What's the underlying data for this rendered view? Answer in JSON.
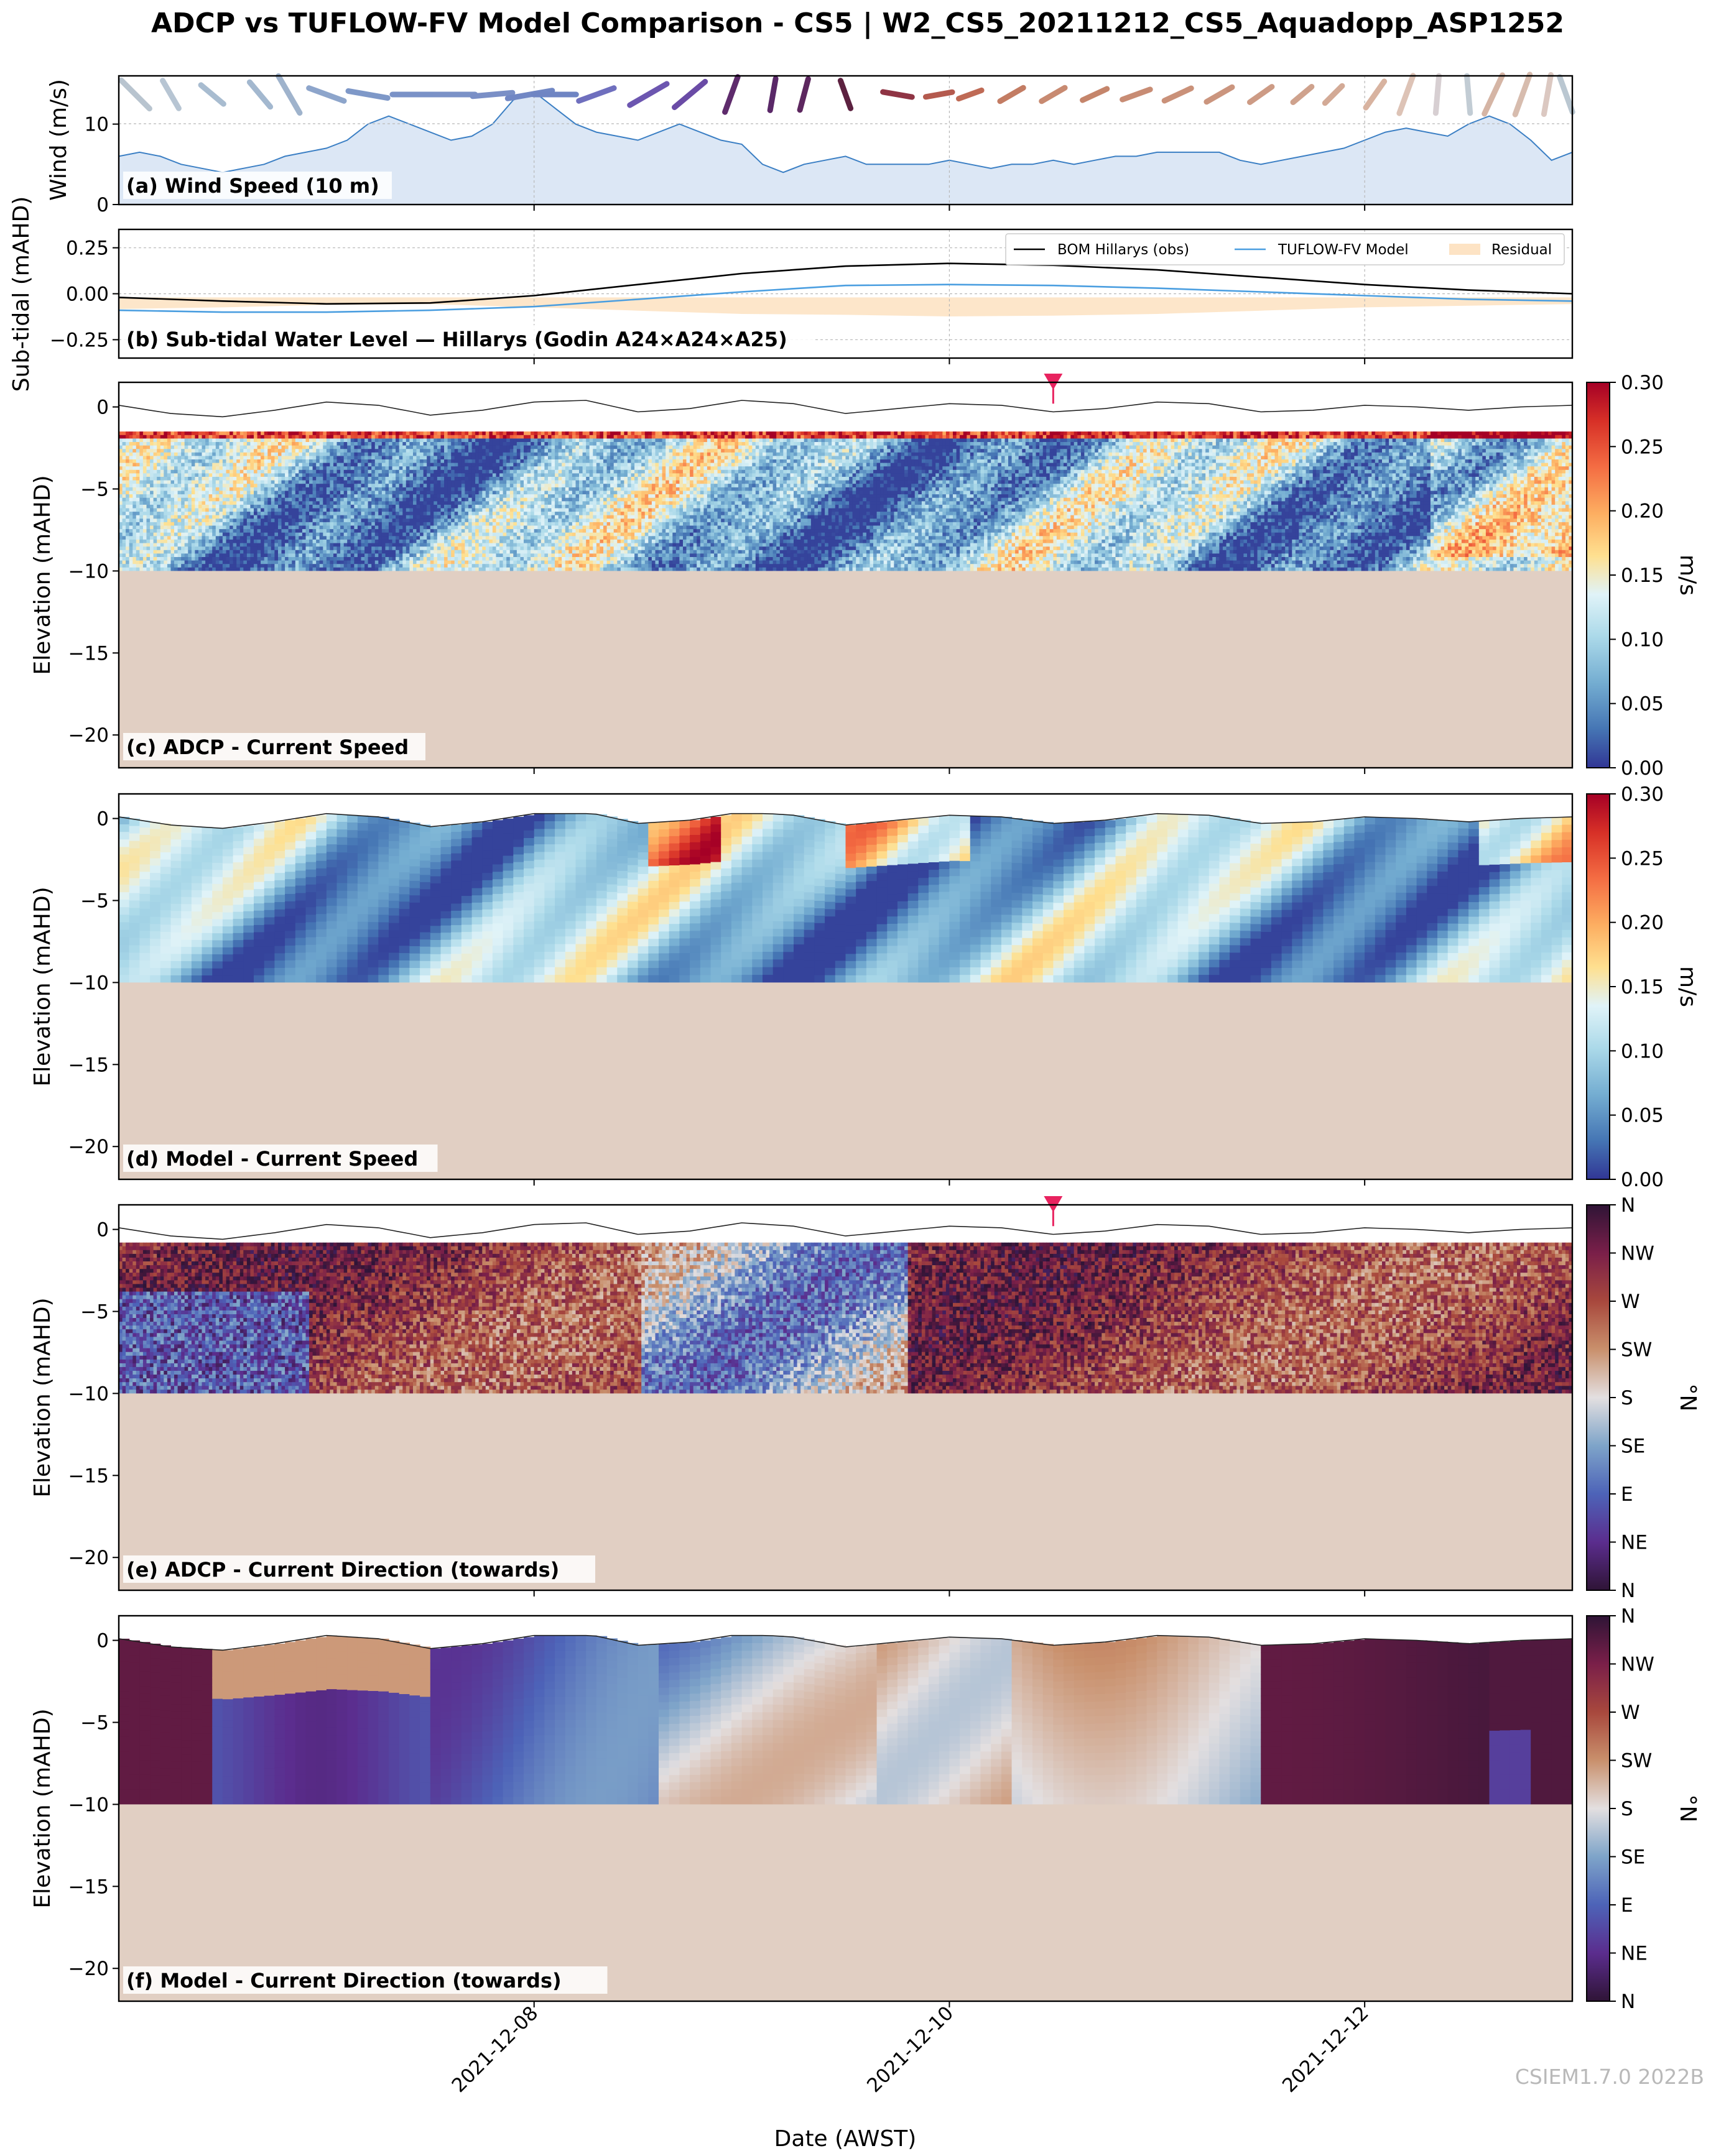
{
  "title": "ADCP vs TUFLOW-FV Model Comparison - CS5 | W2_CS5_20211212_CS5_Aquadopp_ASP1252",
  "watermark": "CSIEM1.7.0 2022B",
  "colors": {
    "wind_fill": "#dce7f5",
    "wind_line": "#3b7fc4",
    "obs_line": "#000000",
    "model_line": "#4a9ee0",
    "residual": "#fde3c4",
    "seabed": "#e1cfc3",
    "marker": "#e8235f"
  },
  "chart_data": [
    {
      "id": "a",
      "type": "area",
      "label": "(a) Wind Speed (10 m)",
      "ylabel": "Wind (m/s)",
      "ylim": [
        0,
        16
      ],
      "yticks": [
        0,
        10
      ],
      "x_start": "2021-12-06",
      "x_end": "2021-12-13",
      "series": [
        {
          "x_days": [
            0,
            0.1,
            0.2,
            0.3,
            0.4,
            0.5,
            0.6,
            0.7,
            0.8,
            0.9,
            1.0,
            1.1,
            1.2,
            1.3,
            1.4,
            1.5,
            1.6,
            1.7,
            1.8,
            1.9,
            2.0,
            2.1,
            2.2,
            2.3,
            2.4,
            2.5,
            2.6,
            2.7,
            2.8,
            2.9,
            3.0,
            3.1,
            3.2,
            3.3,
            3.4,
            3.5,
            3.6,
            3.7,
            3.8,
            3.9,
            4.0,
            4.1,
            4.2,
            4.3,
            4.4,
            4.5,
            4.6,
            4.7,
            4.8,
            4.9,
            5.0,
            5.1,
            5.2,
            5.3,
            5.4,
            5.5,
            5.6,
            5.7,
            5.8,
            5.9,
            6.0,
            6.1,
            6.2,
            6.3,
            6.4,
            6.5,
            6.6,
            6.7,
            6.8,
            6.9,
            7.0
          ],
          "values": [
            6,
            6.5,
            6,
            5,
            4.5,
            4,
            4.5,
            5,
            6,
            6.5,
            7,
            8,
            10,
            11,
            10,
            9,
            8,
            8.5,
            10,
            13,
            14,
            12,
            10,
            9,
            8.5,
            8,
            9,
            10,
            9,
            8,
            7.5,
            5,
            4,
            5,
            5.5,
            6,
            5,
            5,
            5,
            5,
            5.5,
            5,
            4.5,
            5,
            5,
            5.5,
            5,
            5.5,
            6,
            6,
            6.5,
            6.5,
            6.5,
            6.5,
            5.5,
            5,
            5.5,
            6,
            6.5,
            7,
            8,
            9,
            9.5,
            9,
            8.5,
            10,
            11,
            10,
            8,
            5.5,
            6.5
          ]
        }
      ],
      "vectors": [
        {
          "x": 0.08,
          "dir": 315,
          "spd": 11,
          "color": "#b8c4cf"
        },
        {
          "x": 0.25,
          "dir": 330,
          "spd": 8,
          "color": "#b7c5d3"
        },
        {
          "x": 0.45,
          "dir": 310,
          "spd": 7,
          "color": "#a8bcd0"
        },
        {
          "x": 0.68,
          "dir": 320,
          "spd": 8,
          "color": "#a3b8cf"
        },
        {
          "x": 0.82,
          "dir": 330,
          "spd": 12,
          "color": "#9fb3cc"
        },
        {
          "x": 1.0,
          "dir": 290,
          "spd": 10,
          "color": "#8da5cb"
        },
        {
          "x": 1.2,
          "dir": 280,
          "spd": 11,
          "color": "#7e98c8"
        },
        {
          "x": 1.42,
          "dir": 270,
          "spd": 12,
          "color": "#7a92c7"
        },
        {
          "x": 1.62,
          "dir": 270,
          "spd": 11,
          "color": "#7b92c7"
        },
        {
          "x": 1.8,
          "dir": 265,
          "spd": 11,
          "color": "#7a8fc6"
        },
        {
          "x": 1.98,
          "dir": 260,
          "spd": 13,
          "color": "#7187c4"
        },
        {
          "x": 2.1,
          "dir": 270,
          "spd": 12,
          "color": "#6f85c3"
        },
        {
          "x": 2.3,
          "dir": 250,
          "spd": 10,
          "color": "#6f6fbe"
        },
        {
          "x": 2.55,
          "dir": 240,
          "spd": 12,
          "color": "#6c56b0"
        },
        {
          "x": 2.75,
          "dir": 230,
          "spd": 11,
          "color": "#6a4ba6"
        },
        {
          "x": 2.95,
          "dir": 200,
          "spd": 10,
          "color": "#5e2b6c"
        },
        {
          "x": 3.15,
          "dir": 190,
          "spd": 8,
          "color": "#5a2868"
        },
        {
          "x": 3.3,
          "dir": 195,
          "spd": 8,
          "color": "#5d275f"
        },
        {
          "x": 3.5,
          "dir": 160,
          "spd": 7,
          "color": "#5c2140"
        },
        {
          "x": 3.75,
          "dir": 100,
          "spd": 7,
          "color": "#8f3444"
        },
        {
          "x": 3.95,
          "dir": 80,
          "spd": 6,
          "color": "#b45a4e"
        },
        {
          "x": 4.1,
          "dir": 70,
          "spd": 5,
          "color": "#bf6a55"
        },
        {
          "x": 4.3,
          "dir": 60,
          "spd": 6,
          "color": "#c37c63"
        },
        {
          "x": 4.5,
          "dir": 60,
          "spd": 6,
          "color": "#c88a71"
        },
        {
          "x": 4.7,
          "dir": 65,
          "spd": 6,
          "color": "#c5856b"
        },
        {
          "x": 4.9,
          "dir": 70,
          "spd": 7,
          "color": "#c88c74"
        },
        {
          "x": 5.1,
          "dir": 65,
          "spd": 7,
          "color": "#ca9179"
        },
        {
          "x": 5.3,
          "dir": 60,
          "spd": 7,
          "color": "#cb957e"
        },
        {
          "x": 5.5,
          "dir": 55,
          "spd": 6,
          "color": "#cd9b85"
        },
        {
          "x": 5.7,
          "dir": 50,
          "spd": 5,
          "color": "#cfa28d"
        },
        {
          "x": 5.85,
          "dir": 45,
          "spd": 5,
          "color": "#d3aa96"
        },
        {
          "x": 6.05,
          "dir": 35,
          "spd": 8,
          "color": "#d8b3a0"
        },
        {
          "x": 6.2,
          "dir": 20,
          "spd": 11,
          "color": "#ddc3b6"
        },
        {
          "x": 6.35,
          "dir": 5,
          "spd": 10,
          "color": "#d7cfd2"
        },
        {
          "x": 6.5,
          "dir": 355,
          "spd": 10,
          "color": "#c2ccd4"
        },
        {
          "x": 6.62,
          "dir": 25,
          "spd": 12,
          "color": "#d5b5a5"
        },
        {
          "x": 6.76,
          "dir": 20,
          "spd": 12,
          "color": "#d7bcae"
        },
        {
          "x": 6.88,
          "dir": 10,
          "spd": 11,
          "color": "#dbc8c1"
        },
        {
          "x": 6.97,
          "dir": 340,
          "spd": 10,
          "color": "#bac7d1"
        }
      ]
    },
    {
      "id": "b",
      "type": "line",
      "label": "(b) Sub-tidal Water Level — Hillarys (Godin A24×A24×A25)",
      "ylabel": "Sub-tidal (mAHD)",
      "ylim": [
        -0.35,
        0.35
      ],
      "yticks": [
        -0.25,
        0.0,
        0.25
      ],
      "ytick_labels": [
        "−0.25",
        "0.00",
        "0.25"
      ],
      "legend": [
        "BOM Hillarys (obs)",
        "TUFLOW-FV Model",
        "Residual"
      ],
      "series": [
        {
          "name": "BOM Hillarys (obs)",
          "x_days": [
            0,
            0.5,
            1.0,
            1.5,
            2.0,
            2.5,
            3.0,
            3.5,
            4.0,
            4.5,
            5.0,
            5.5,
            6.0,
            6.5,
            7.0
          ],
          "values": [
            -0.02,
            -0.04,
            -0.055,
            -0.05,
            -0.01,
            0.05,
            0.11,
            0.15,
            0.165,
            0.155,
            0.13,
            0.09,
            0.05,
            0.02,
            0.0
          ]
        },
        {
          "name": "TUFLOW-FV Model",
          "x_days": [
            0,
            0.5,
            1.0,
            1.5,
            2.0,
            2.5,
            3.0,
            3.5,
            4.0,
            4.5,
            5.0,
            5.5,
            6.0,
            6.5,
            7.0
          ],
          "values": [
            -0.09,
            -0.1,
            -0.1,
            -0.09,
            -0.07,
            -0.03,
            0.01,
            0.045,
            0.05,
            0.045,
            0.03,
            0.01,
            -0.01,
            -0.03,
            -0.04
          ]
        }
      ]
    },
    {
      "id": "c",
      "type": "heatmap",
      "label": "(c) ADCP - Current Speed",
      "ylabel": "Elevation (mAHD)",
      "ylim": [
        -22,
        1.5
      ],
      "yticks": [
        0,
        -5,
        -10,
        -15,
        -20
      ],
      "ytick_labels": [
        "0",
        "−5",
        "−10",
        "−15",
        "−20"
      ],
      "colorbar": {
        "label": "m/s",
        "min": 0,
        "max": 0.3,
        "ticks": [
          "0.00",
          "0.05",
          "0.10",
          "0.15",
          "0.20",
          "0.25",
          "0.30"
        ],
        "cmap": "RdYlBu_r"
      },
      "bed_elevation": -10,
      "surface_bin_elevation": -1.5,
      "marker_day": 4.5
    },
    {
      "id": "d",
      "type": "heatmap",
      "label": "(d) Model - Current Speed",
      "ylabel": "Elevation (mAHD)",
      "ylim": [
        -22,
        1.5
      ],
      "yticks": [
        0,
        -5,
        -10,
        -15,
        -20
      ],
      "ytick_labels": [
        "0",
        "−5",
        "−10",
        "−15",
        "−20"
      ],
      "colorbar": {
        "label": "m/s",
        "min": 0,
        "max": 0.3,
        "ticks": [
          "0.00",
          "0.05",
          "0.10",
          "0.15",
          "0.20",
          "0.25",
          "0.30"
        ],
        "cmap": "RdYlBu_r"
      },
      "bed_elevation": -10
    },
    {
      "id": "e",
      "type": "heatmap",
      "label": "(e) ADCP - Current Direction (towards)",
      "ylabel": "Elevation (mAHD)",
      "ylim": [
        -22,
        1.5
      ],
      "yticks": [
        0,
        -5,
        -10,
        -15,
        -20
      ],
      "ytick_labels": [
        "0",
        "−5",
        "−10",
        "−15",
        "−20"
      ],
      "colorbar": {
        "label": "°N",
        "min": 0,
        "max": 360,
        "ticks": [
          "N",
          "NE",
          "E",
          "SE",
          "S",
          "SW",
          "W",
          "NW",
          "N"
        ],
        "cmap": "twilight_shifted"
      },
      "bed_elevation": -10,
      "marker_day": 4.5
    },
    {
      "id": "f",
      "type": "heatmap",
      "label": "(f) Model - Current Direction (towards)",
      "ylabel": "Elevation (mAHD)",
      "ylim": [
        -22,
        1.5
      ],
      "yticks": [
        0,
        -5,
        -10,
        -15,
        -20
      ],
      "ytick_labels": [
        "0",
        "−5",
        "−10",
        "−15",
        "−20"
      ],
      "colorbar": {
        "label": "°N",
        "min": 0,
        "max": 360,
        "ticks": [
          "N",
          "NE",
          "E",
          "SE",
          "S",
          "SW",
          "W",
          "NW",
          "N"
        ],
        "cmap": "twilight_shifted"
      },
      "bed_elevation": -10
    }
  ],
  "water_surface": {
    "x_days": [
      0,
      0.25,
      0.5,
      0.75,
      1.0,
      1.25,
      1.5,
      1.75,
      2.0,
      2.25,
      2.5,
      2.75,
      3.0,
      3.25,
      3.5,
      3.75,
      4.0,
      4.25,
      4.5,
      4.75,
      5.0,
      5.25,
      5.5,
      5.75,
      6.0,
      6.25,
      6.5,
      6.75,
      7.0
    ],
    "values": [
      0.1,
      -0.4,
      -0.6,
      -0.2,
      0.3,
      0.1,
      -0.5,
      -0.2,
      0.3,
      0.4,
      -0.3,
      -0.1,
      0.4,
      0.2,
      -0.4,
      -0.1,
      0.2,
      0.1,
      -0.3,
      -0.1,
      0.3,
      0.2,
      -0.3,
      -0.2,
      0.1,
      0.0,
      -0.2,
      0.0,
      0.1
    ]
  },
  "x_axis": {
    "label": "Date (AWST)",
    "ticks": [
      "2021-12-08",
      "2021-12-10",
      "2021-12-12"
    ],
    "tick_days": [
      2,
      4,
      6
    ]
  }
}
